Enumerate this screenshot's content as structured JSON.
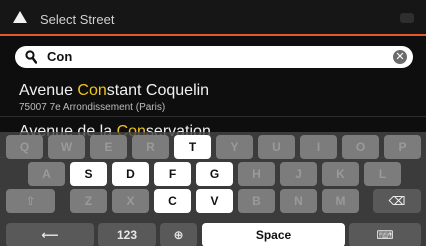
{
  "header": {
    "title": "Select Street"
  },
  "search": {
    "value": "Con"
  },
  "results": [
    {
      "pre": "Avenue ",
      "hl": "Con",
      "post": "stant Coquelin",
      "sub": "75007 7e Arrondissement (Paris)"
    },
    {
      "pre": "Avenue de la ",
      "hl": "Con",
      "post": "servation",
      "sub": ""
    }
  ],
  "keyboard": {
    "row1": [
      "Q",
      "W",
      "E",
      "R",
      "T",
      "Y",
      "U",
      "I",
      "O",
      "P"
    ],
    "row2": [
      "A",
      "S",
      "D",
      "F",
      "G",
      "H",
      "J",
      "K",
      "L"
    ],
    "row3": [
      "Z",
      "X",
      "C",
      "V",
      "B",
      "N",
      "M"
    ],
    "enabled": [
      "T",
      "S",
      "D",
      "F",
      "G",
      "C",
      "V"
    ],
    "numbers_label": "123",
    "space_label": "Space"
  },
  "colors": {
    "accent": "#e4582f",
    "highlight": "#f0c420"
  }
}
